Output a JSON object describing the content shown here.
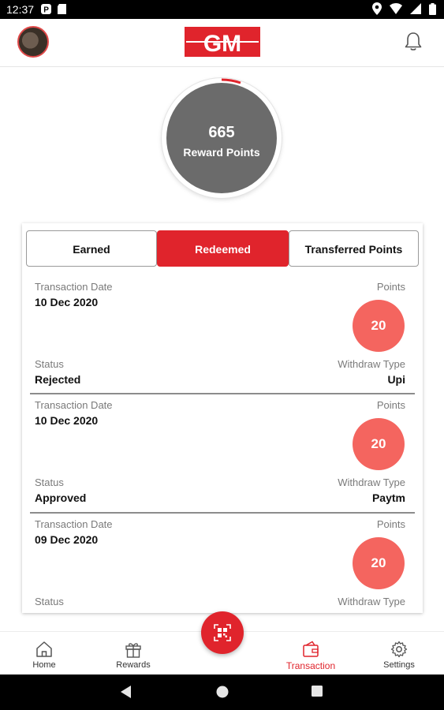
{
  "status_bar": {
    "time": "12:37"
  },
  "header": {
    "logo_text": "GM"
  },
  "points": {
    "value": "665",
    "label": "Reward Points"
  },
  "tabs": [
    {
      "label": "Earned",
      "active": false
    },
    {
      "label": "Redeemed",
      "active": true
    },
    {
      "label": "Transferred Points",
      "active": false
    }
  ],
  "transactions": [
    {
      "date_label": "Transaction Date",
      "date": "10 Dec 2020",
      "points_label": "Points",
      "points": "20",
      "status_label": "Status",
      "status": "Rejected",
      "type_label": "Withdraw Type",
      "type": "Upi"
    },
    {
      "date_label": "Transaction Date",
      "date": "10 Dec 2020",
      "points_label": "Points",
      "points": "20",
      "status_label": "Status",
      "status": "Approved",
      "type_label": "Withdraw Type",
      "type": "Paytm"
    },
    {
      "date_label": "Transaction Date",
      "date": "09 Dec 2020",
      "points_label": "Points",
      "points": "20",
      "status_label": "Status",
      "status": "",
      "type_label": "Withdraw Type",
      "type": ""
    }
  ],
  "nav": [
    {
      "label": "Home",
      "icon": "home-icon"
    },
    {
      "label": "Rewards",
      "icon": "gift-icon"
    },
    {
      "label": "Transaction",
      "icon": "wallet-icon",
      "active": true
    },
    {
      "label": "Settings",
      "icon": "gear-icon"
    }
  ],
  "colors": {
    "accent": "#e0242c",
    "badge": "#f4655f",
    "points_circle": "#6b6b6b"
  }
}
